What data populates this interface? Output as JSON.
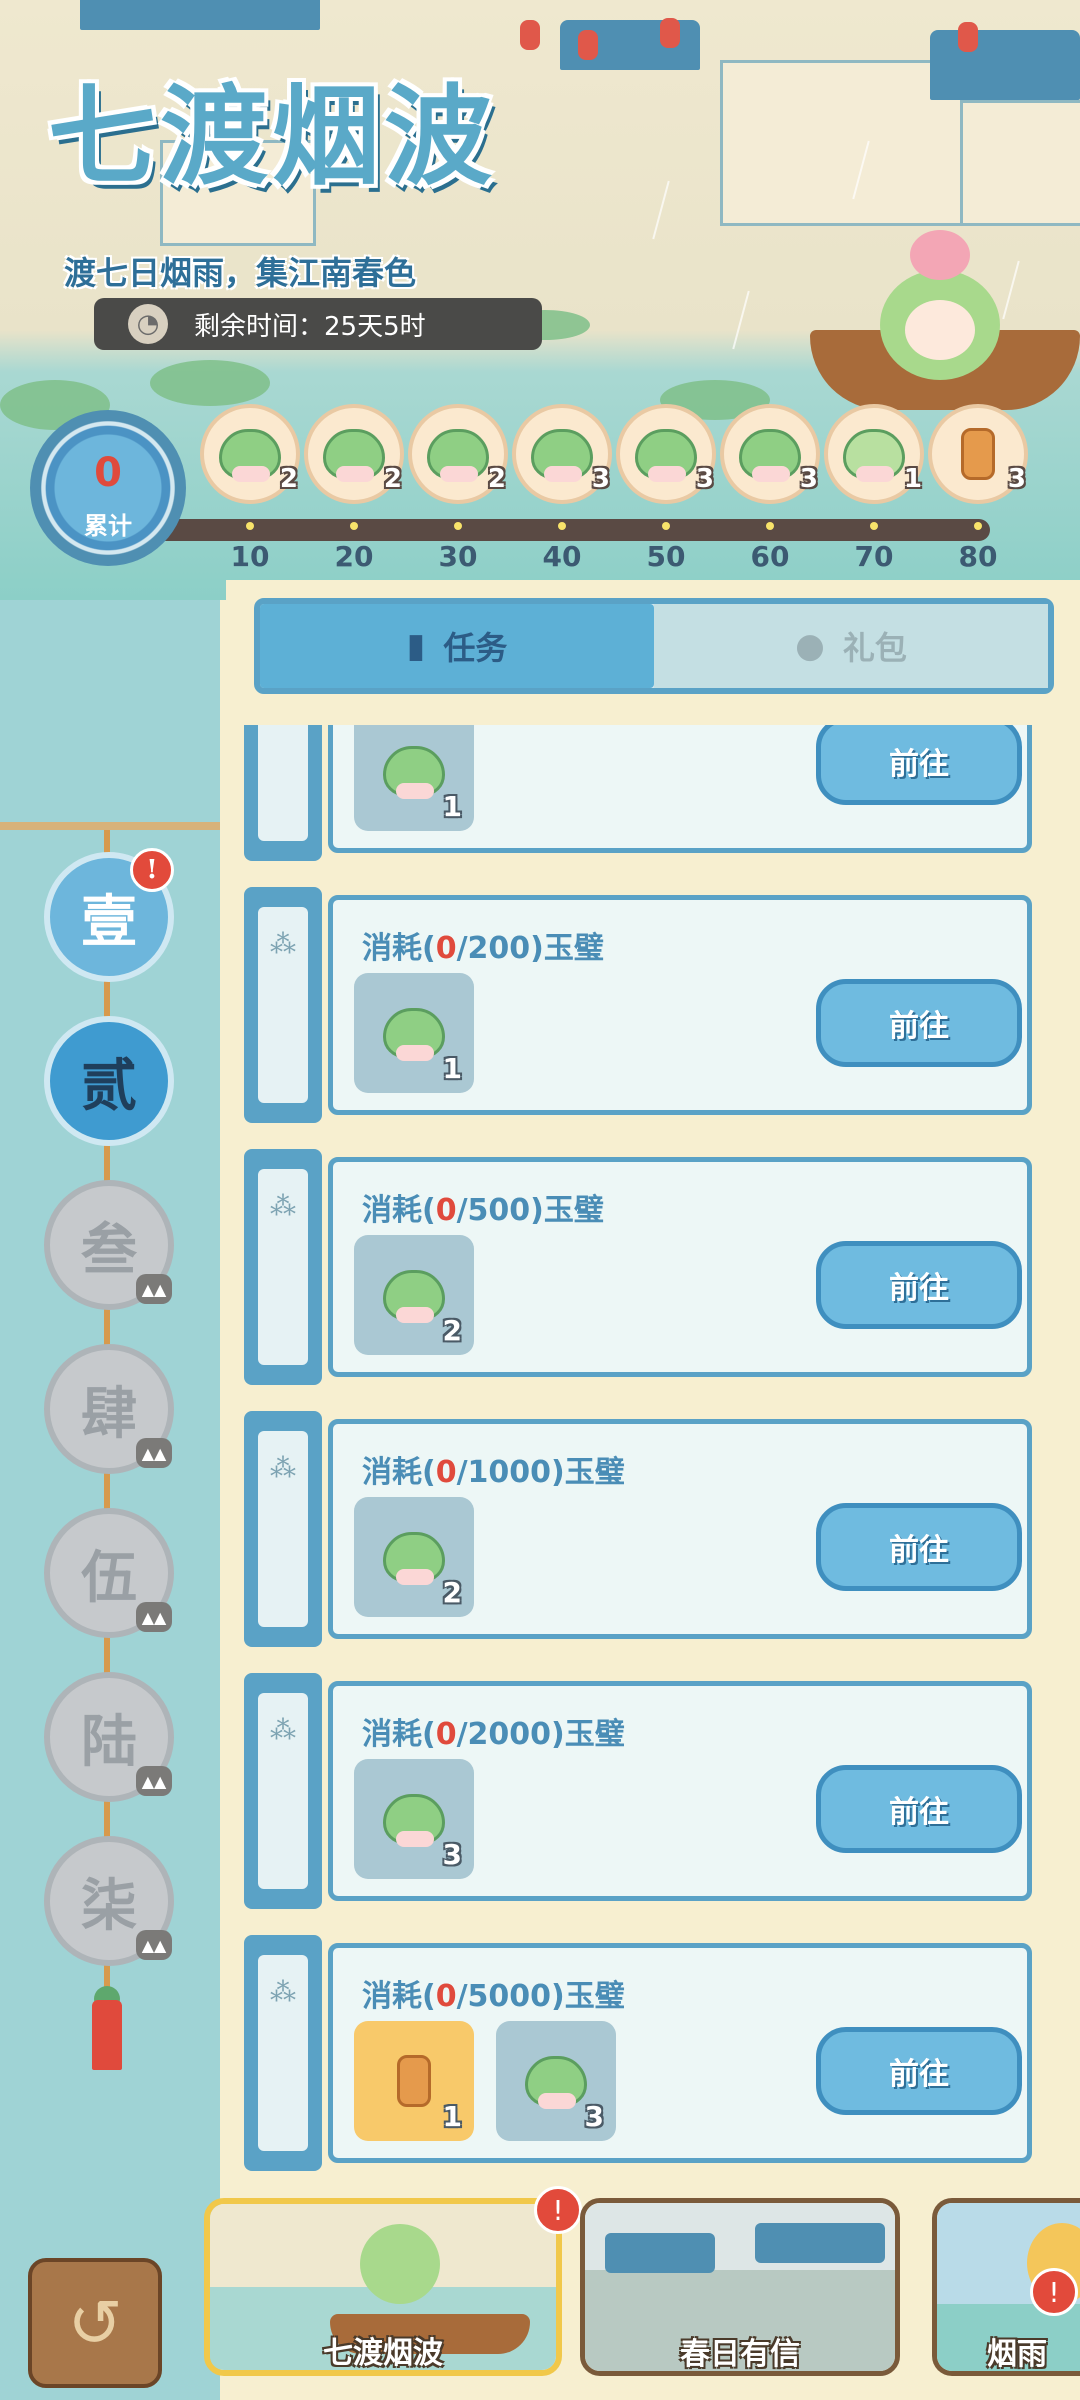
{
  "event": {
    "title": "七渡烟波",
    "subtitle": "渡七日烟雨，集江南春色",
    "time_remaining": "剩余时间：25天5时"
  },
  "progress": {
    "total_value": "0",
    "total_label": "累计",
    "milestones": [
      {
        "threshold": "10",
        "count": "2",
        "icon": "frog-icon"
      },
      {
        "threshold": "20",
        "count": "2",
        "icon": "frog-icon"
      },
      {
        "threshold": "30",
        "count": "2",
        "icon": "frog-icon"
      },
      {
        "threshold": "40",
        "count": "3",
        "icon": "frog-icon"
      },
      {
        "threshold": "50",
        "count": "3",
        "icon": "frog-icon"
      },
      {
        "threshold": "60",
        "count": "3",
        "icon": "frog-icon"
      },
      {
        "threshold": "70",
        "count": "1",
        "icon": "frog-stack-icon"
      },
      {
        "threshold": "80",
        "count": "3",
        "icon": "jar-icon"
      }
    ]
  },
  "tabs": [
    {
      "label": "任务",
      "icon": "book-icon",
      "active": true
    },
    {
      "label": "礼包",
      "icon": "bag-icon",
      "active": false
    }
  ],
  "chapters": [
    {
      "label": "壹",
      "state": "open",
      "alert": "!"
    },
    {
      "label": "贰",
      "state": "active"
    },
    {
      "label": "叁",
      "state": "locked"
    },
    {
      "label": "肆",
      "state": "locked"
    },
    {
      "label": "伍",
      "state": "locked"
    },
    {
      "label": "陆",
      "state": "locked"
    },
    {
      "label": "柒",
      "state": "locked"
    }
  ],
  "tasks": [
    {
      "prefix": "",
      "current": "",
      "suffix": "",
      "rewards": [
        {
          "type": "frog",
          "count": "1"
        }
      ],
      "button": "前往"
    },
    {
      "prefix": "消耗(",
      "current": "0",
      "suffix": "/200)玉璧",
      "rewards": [
        {
          "type": "frog",
          "count": "1"
        }
      ],
      "button": "前往"
    },
    {
      "prefix": "消耗(",
      "current": "0",
      "suffix": "/500)玉璧",
      "rewards": [
        {
          "type": "frog",
          "count": "2"
        }
      ],
      "button": "前往"
    },
    {
      "prefix": "消耗(",
      "current": "0",
      "suffix": "/1000)玉璧",
      "rewards": [
        {
          "type": "frog",
          "count": "2"
        }
      ],
      "button": "前往"
    },
    {
      "prefix": "消耗(",
      "current": "0",
      "suffix": "/2000)玉璧",
      "rewards": [
        {
          "type": "frog",
          "count": "3"
        }
      ],
      "button": "前往"
    },
    {
      "prefix": "消耗(",
      "current": "0",
      "suffix": "/5000)玉璧",
      "rewards": [
        {
          "type": "jar",
          "count": "1"
        },
        {
          "type": "frog",
          "count": "3"
        }
      ],
      "button": "前往"
    }
  ],
  "bottom_nav": [
    {
      "label": "七渡烟波",
      "selected": true,
      "alert": "!"
    },
    {
      "label": "春日有信",
      "selected": false
    },
    {
      "label": "烟雨",
      "selected": false,
      "alert": "!"
    }
  ],
  "colors": {
    "accent": "#5aa2c6",
    "alert": "#e24a3b",
    "highlight": "#e04a3c"
  }
}
